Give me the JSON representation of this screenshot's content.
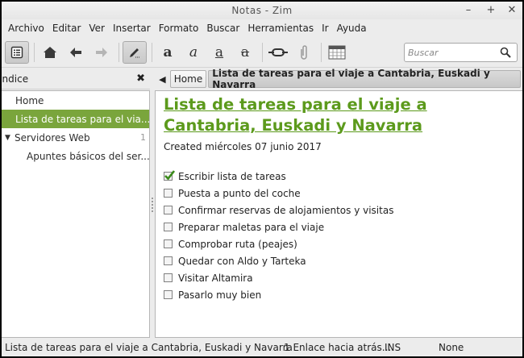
{
  "window": {
    "title": "Notas - Zim"
  },
  "menubar": [
    "Archivo",
    "Editar",
    "Ver",
    "Insertar",
    "Formato",
    "Buscar",
    "Herramientas",
    "Ir",
    "Ayuda"
  ],
  "toolbar": {
    "icons": [
      "index-icon",
      "home-icon",
      "back-arrow-icon",
      "forward-arrow-icon",
      "edit-pencil-icon",
      "bold-icon",
      "italic-icon",
      "underline-icon",
      "strikethrough-icon",
      "link-icon",
      "attach-icon",
      "calendar-icon"
    ],
    "format_bold": "a",
    "format_italic": "a",
    "format_underline": "a",
    "format_strike": "a",
    "search_placeholder": "Buscar"
  },
  "sidebar": {
    "title": "Índice",
    "close": "✖",
    "items": [
      {
        "label": "Home",
        "level": 0
      },
      {
        "label": "Lista de tareas para el via...",
        "level": 0,
        "selected": true
      },
      {
        "label": "Servidores Web",
        "level": 0,
        "expanded": true,
        "count": "1"
      },
      {
        "label": "Apuntes básicos del ser...",
        "level": 1
      }
    ]
  },
  "pathbar": {
    "back": "◀",
    "items": [
      "Home",
      "Lista de tareas para el viaje a Cantabria, Euskadi y Navarra"
    ]
  },
  "page": {
    "title": "Lista de tareas para el viaje a Cantabria, Euskadi y Navarra",
    "created": "Created miércoles 07 junio 2017",
    "tasks": [
      {
        "label": "Escribir lista de tareas",
        "done": true
      },
      {
        "label": "Puesta a punto del coche",
        "done": false
      },
      {
        "label": "Confirmar reservas de alojamientos y visitas",
        "done": false
      },
      {
        "label": "Preparar maletas para el viaje",
        "done": false
      },
      {
        "label": "Comprobar ruta (peajes)",
        "done": false
      },
      {
        "label": "Quedar con Aldo y Tarteka",
        "done": false
      },
      {
        "label": "Visitar Altamira",
        "done": false
      },
      {
        "label": "Pasarlo muy bien",
        "done": false
      }
    ]
  },
  "statusbar": {
    "page": "Lista de tareas para el viaje a Cantabria, Euskadi y Navarra",
    "links": "1 Enlace hacia atrás...",
    "mode": "INS",
    "style": "None"
  },
  "colors": {
    "accent": "#7aa53c",
    "heading": "#5c9a1c",
    "check": "#3a8a1a"
  }
}
